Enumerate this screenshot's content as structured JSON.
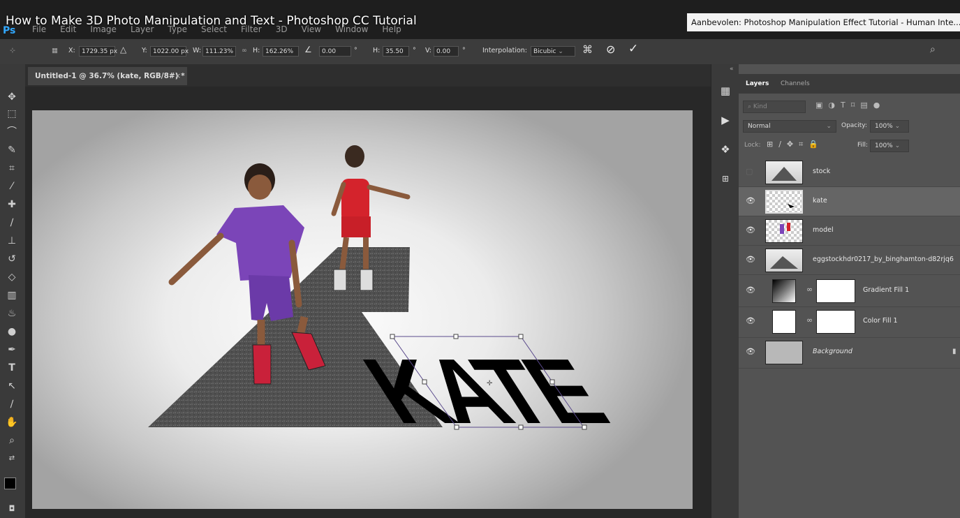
{
  "video": {
    "title": "How to Make 3D Photo Manipulation and Text - Photoshop CC Tutorial",
    "recommended": "Aanbevolen: Photoshop Manipulation Effect Tutorial - Human Inte... ("
  },
  "app": {
    "logo": "Ps"
  },
  "menu": [
    "File",
    "Edit",
    "Image",
    "Layer",
    "Type",
    "Select",
    "Filter",
    "3D",
    "View",
    "Window",
    "Help"
  ],
  "options": {
    "x_label": "X:",
    "x_value": "1729.35 px",
    "y_label": "Y:",
    "y_value": "1022.00 px",
    "w_label": "W:",
    "w_value": "111.23%",
    "h_label": "H:",
    "h_value": "162.26%",
    "angle_value": "0.00",
    "degree": "°",
    "hskew_label": "H:",
    "hskew_value": "35.50",
    "vskew_label": "V:",
    "vskew_value": "0.00",
    "interp_label": "Interpolation:",
    "interp_value": "Bicubic"
  },
  "document": {
    "tab": "Untitled-1 @ 36.7% (kate, RGB/8#) *",
    "close": "×"
  },
  "canvas": {
    "text": "KATE"
  },
  "panel": {
    "tabs": [
      "Layers",
      "Channels"
    ],
    "kind": "Kind",
    "blend_mode": "Normal",
    "opacity_label": "Opacity:",
    "opacity_value": "100%",
    "lock_label": "Lock:",
    "fill_label": "Fill:",
    "fill_value": "100%",
    "collapse": "«"
  },
  "layers": [
    {
      "name": "stock",
      "visible": false
    },
    {
      "name": "kate",
      "visible": true,
      "selected": true
    },
    {
      "name": "model",
      "visible": true
    },
    {
      "name": "eggstockhdr0217_by_binghamton-d82rjq6",
      "visible": true
    },
    {
      "name": "Gradient Fill 1",
      "visible": true
    },
    {
      "name": "Color Fill 1",
      "visible": true
    },
    {
      "name": "Background",
      "visible": true
    }
  ],
  "colors": {
    "accent": "#31a8ff",
    "panel": "#535353",
    "selected_layer": "#656565"
  }
}
